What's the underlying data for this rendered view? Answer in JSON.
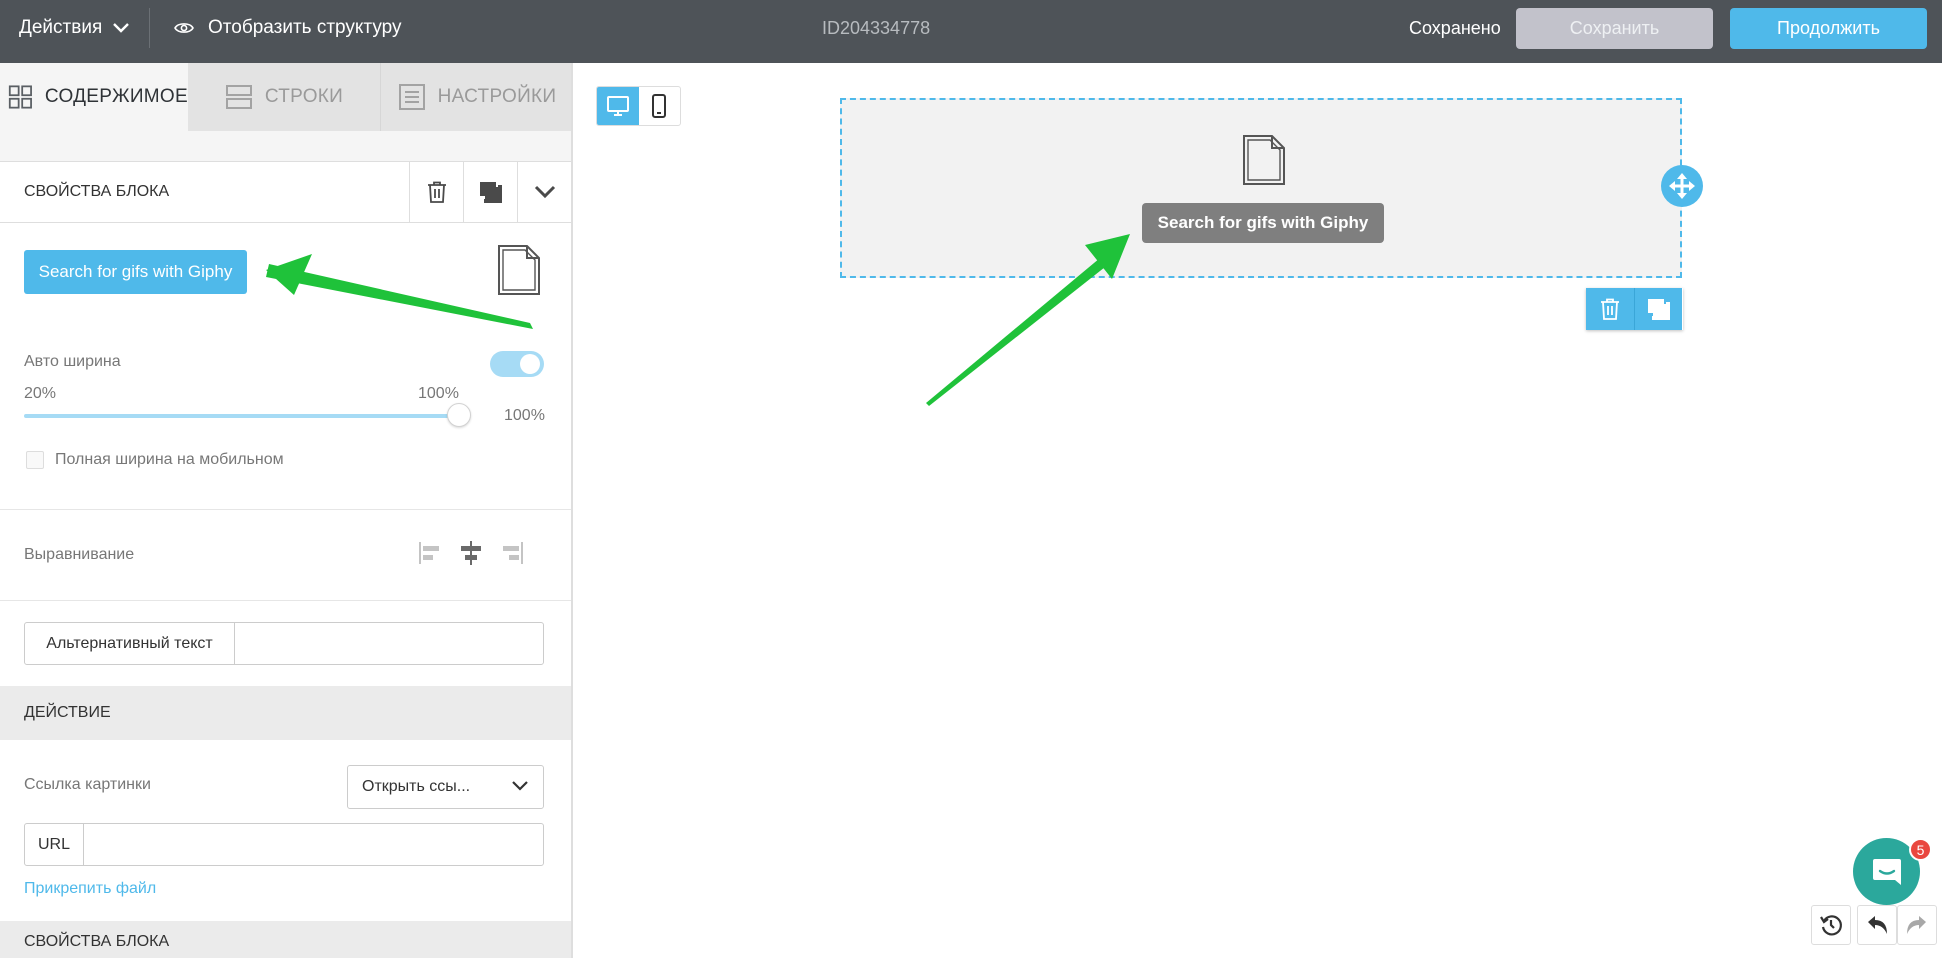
{
  "topbar": {
    "actions_label": "Действия",
    "structure_label": "Отобразить структуру",
    "document_id": "ID204334778",
    "saved_status": "Сохранено",
    "save_label": "Сохранить",
    "continue_label": "Продолжить"
  },
  "sidebar": {
    "tabs": [
      {
        "label": "СОДЕРЖИМОЕ",
        "icon": "grid-icon",
        "active": true
      },
      {
        "label": "СТРОКИ",
        "icon": "rows-icon",
        "active": false
      },
      {
        "label": "НАСТРОЙКИ",
        "icon": "settings-list-icon",
        "active": false
      }
    ],
    "block_props_title": "СВОЙСТВА БЛОКА",
    "giphy_button": "Search for gifs with Giphy",
    "auto_width_label": "Авто ширина",
    "auto_width_enabled": true,
    "slider_min_label": "20%",
    "slider_max_label": "100%",
    "slider_value": "100%",
    "slider_level_percent": 100,
    "full_width_mobile_label": "Полная ширина на мобильном",
    "full_width_mobile_checked": false,
    "align_label": "Выравнивание",
    "alt_text_label": "Альтернативный текст",
    "alt_text_value": "",
    "action_section": "ДЕЙСТВИЕ",
    "image_link_label": "Ссылка картинки",
    "image_link_select": "Открыть ссы...",
    "url_label": "URL",
    "url_value": "",
    "attach_file_link": "Прикрепить файл",
    "block_props_title_2": "СВОЙСТВА БЛОКА"
  },
  "canvas": {
    "device_modes": [
      "desktop-icon",
      "mobile-icon"
    ],
    "active_device": "desktop",
    "block_button": "Search for gifs with Giphy"
  },
  "chat": {
    "badge_count": "5"
  },
  "colors": {
    "topbar_bg": "#4e5358",
    "accent": "#4fb9ea",
    "annotation_arrow": "#1fc23a",
    "chat": "#2ba89c",
    "badge": "#e9473f"
  }
}
